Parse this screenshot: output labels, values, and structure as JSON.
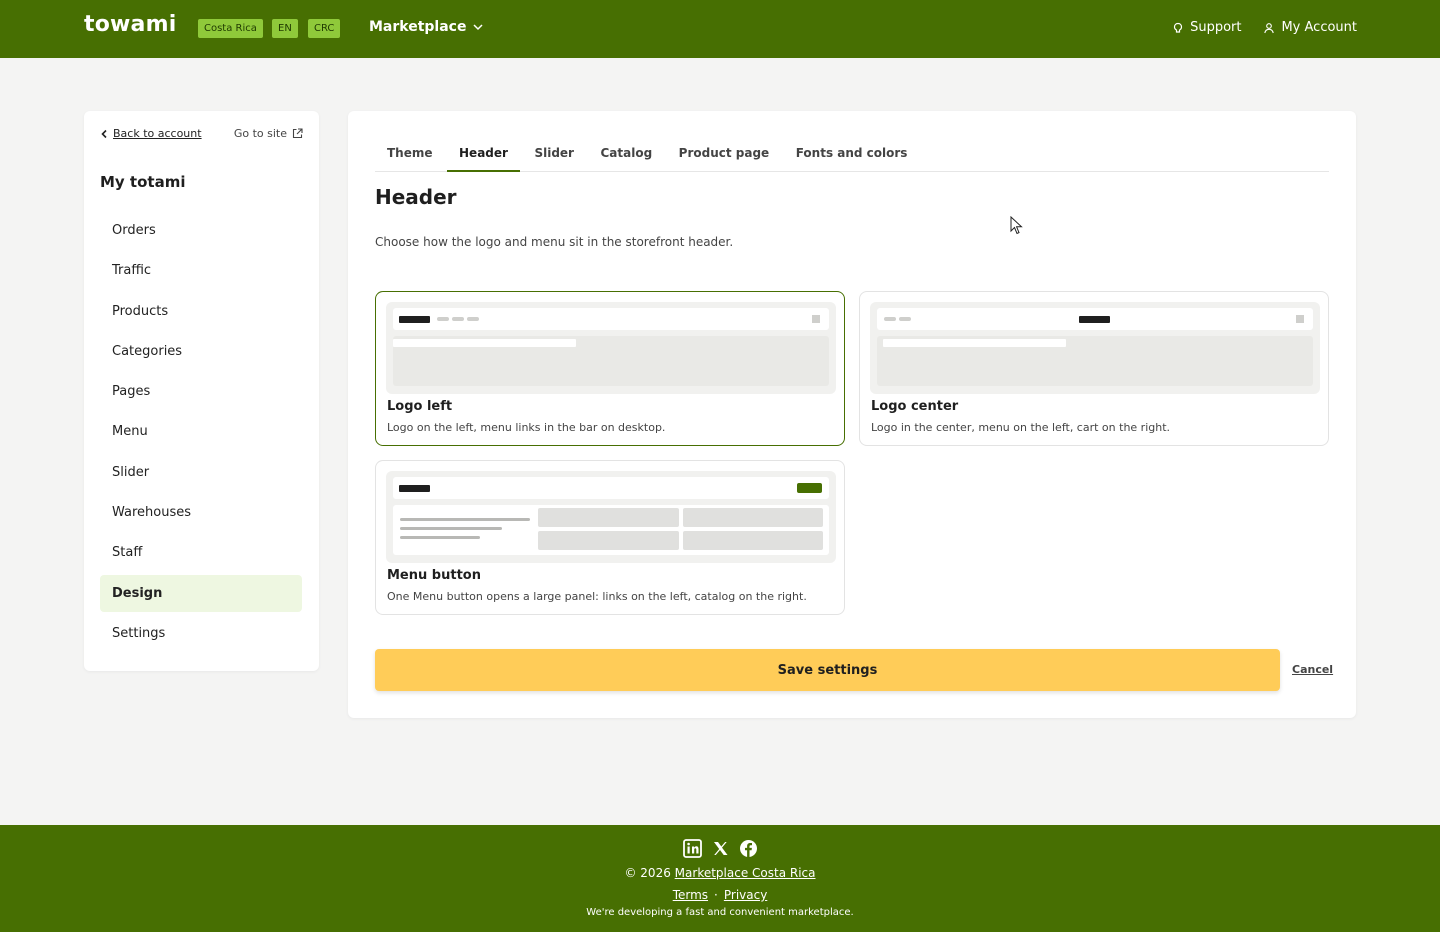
{
  "topbar": {
    "logo": "towami",
    "country": "Costa Rica",
    "language": "EN",
    "currency": "CRC",
    "marketplace": "Marketplace",
    "support": "Support",
    "account": "My Account"
  },
  "sidebar": {
    "back": "Back to account",
    "go_to_site": "Go to site",
    "title": "My totami",
    "items": [
      {
        "label": "Orders"
      },
      {
        "label": "Traffic"
      },
      {
        "label": "Products"
      },
      {
        "label": "Categories"
      },
      {
        "label": "Pages"
      },
      {
        "label": "Menu"
      },
      {
        "label": "Slider"
      },
      {
        "label": "Warehouses"
      },
      {
        "label": "Staff"
      },
      {
        "label": "Design",
        "active": true
      },
      {
        "label": "Settings"
      }
    ]
  },
  "tabs": [
    "Theme",
    "Header",
    "Slider",
    "Catalog",
    "Product page",
    "Fonts and colors"
  ],
  "active_tab": "Header",
  "main": {
    "title": "Header",
    "description": "Choose how the logo and menu sit in the storefront header.",
    "options": [
      {
        "title": "Logo left",
        "description": "Logo on the left, menu links in the bar on desktop.",
        "selected": true
      },
      {
        "title": "Logo center",
        "description": "Logo in the center, menu on the left, cart on the right.",
        "selected": false
      },
      {
        "title": "Menu button",
        "description": "One Menu button opens a large panel: links on the left, catalog on the right.",
        "selected": false
      }
    ],
    "save": "Save settings",
    "cancel": "Cancel"
  },
  "footer": {
    "copyright_prefix": "© 2026",
    "copyright_link": "Marketplace Costa Rica",
    "terms": "Terms",
    "separator": "·",
    "privacy": "Privacy",
    "tagline": "We're developing a fast and convenient marketplace."
  },
  "colors": {
    "brand_green": "#476f02",
    "badge_green": "#8fc93a",
    "save_yellow": "#ffcc58",
    "active_bg": "#eef7e1"
  },
  "icons": [
    "chevron-down-icon",
    "support-icon",
    "user-icon",
    "chevron-left-icon",
    "external-link-icon",
    "linkedin-icon",
    "x-icon",
    "facebook-icon"
  ]
}
